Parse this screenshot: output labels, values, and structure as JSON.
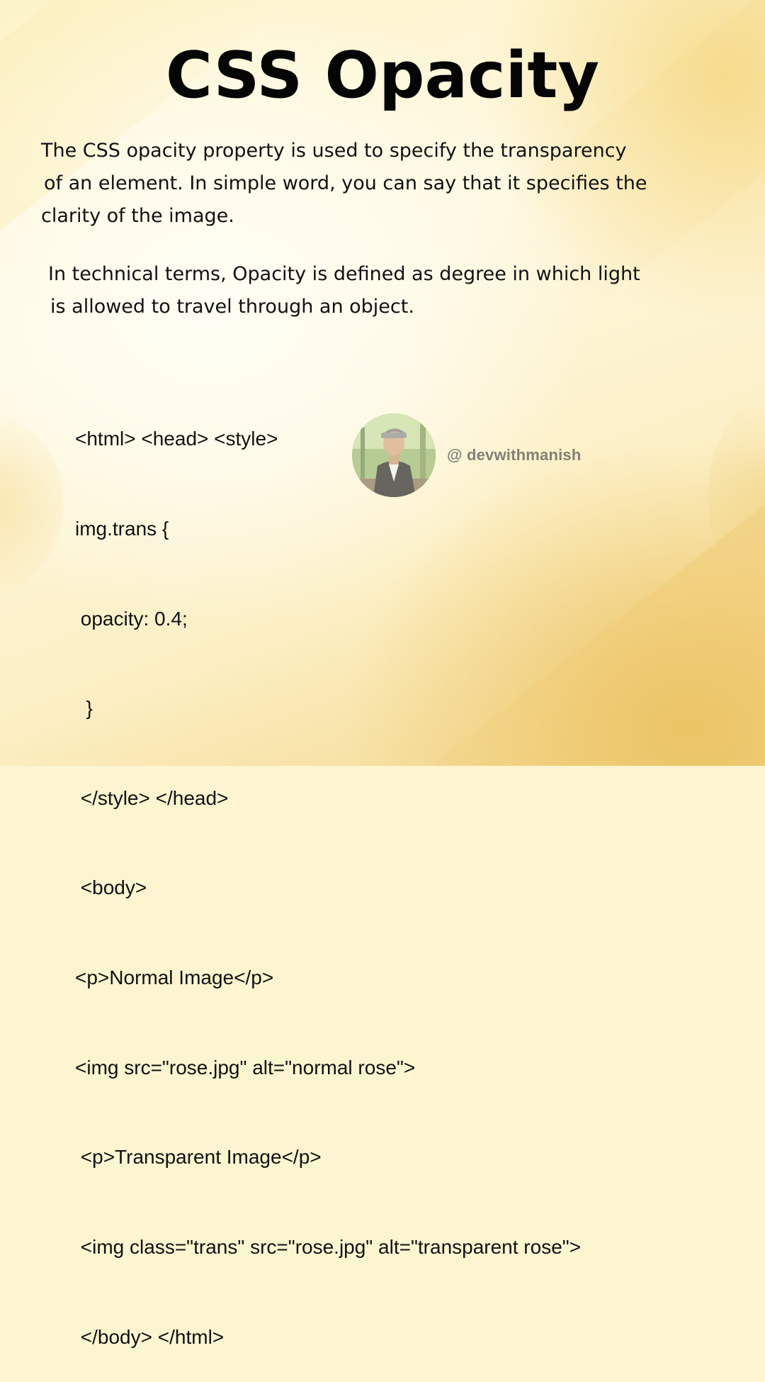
{
  "title": "CSS Opacity",
  "paragraphs": [
    {
      "lines": [
        "The CSS opacity property is used to specify the transparency",
        "of an element. In simple word, you can say that it specifies the",
        "clarity of the image."
      ]
    },
    {
      "lines": [
        "In technical terms, Opacity is defined as degree in which light",
        "is allowed to travel through an object."
      ]
    }
  ],
  "code_lines": [
    "<html> <head> <style>",
    "img.trans {",
    " opacity: 0.4;",
    "  }",
    " </style> </head>",
    " <body>",
    "<p>Normal Image</p>",
    "<img src=\"rose.jpg\" alt=\"normal rose\">",
    " <p>Transparent Image</p>",
    " <img class=\"trans\" src=\"rose.jpg\" alt=\"transparent rose\">",
    " </body> </html>"
  ],
  "watermark": {
    "handle": "@ devwithmanish"
  }
}
